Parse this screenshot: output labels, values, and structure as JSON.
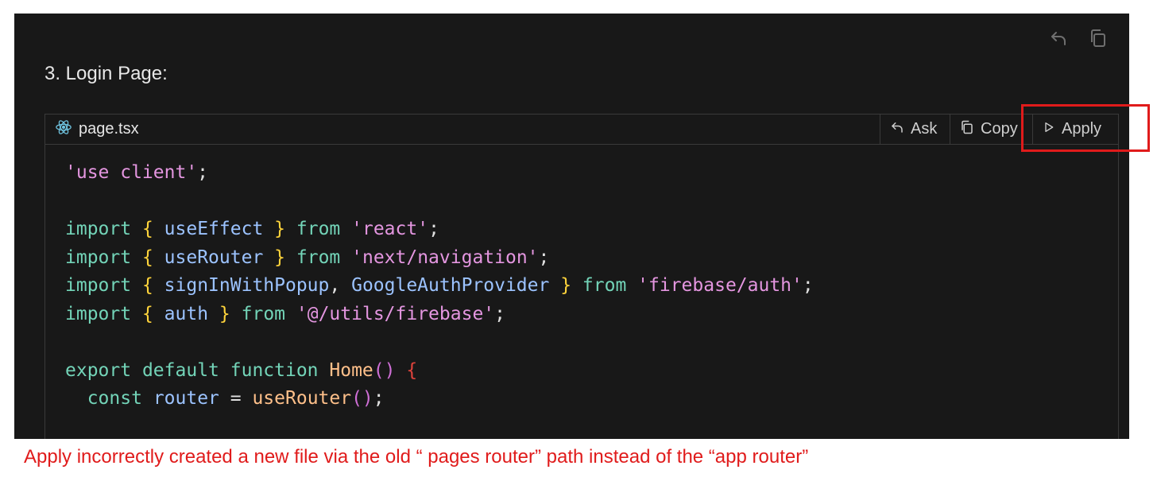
{
  "section": {
    "heading": "3. Login Page:"
  },
  "top_actions": {
    "undo_icon": "undo-icon",
    "copy_icon": "copy-icon"
  },
  "code_header": {
    "filename": "page.tsx",
    "file_icon": "react-icon",
    "ask_label": "Ask",
    "copy_label": "Copy",
    "apply_label": "Apply"
  },
  "code_lines": [
    "'use client';",
    "",
    "import { useEffect } from 'react';",
    "import { useRouter } from 'next/navigation';",
    "import { signInWithPopup, GoogleAuthProvider } from 'firebase/auth';",
    "import { auth } from '@/utils/firebase';",
    "",
    "export default function Home() {",
    "  const router = useRouter();"
  ],
  "annotation": {
    "caption": "Apply incorrectly created a new file via the old “ pages router” path instead of the “app router”",
    "highlight_color": "#e01b1b"
  }
}
